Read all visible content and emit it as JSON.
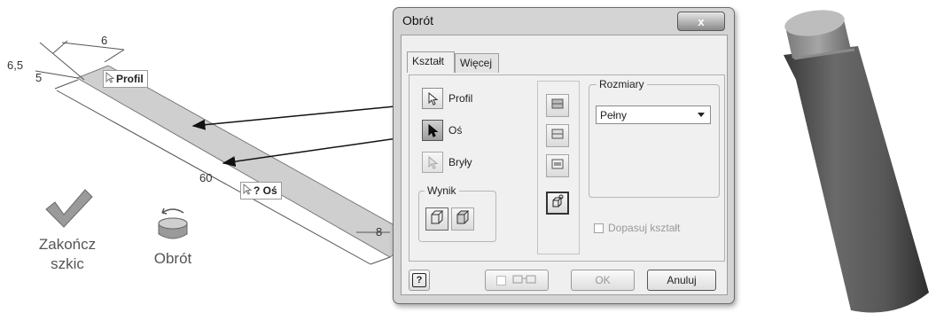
{
  "sketch": {
    "dimensions": {
      "d1": "6,5",
      "d2": "5",
      "d3": "6",
      "d4": "60",
      "d5": "8"
    },
    "profile_tag": "Profil",
    "axis_tag": "? Oś"
  },
  "ribbon": {
    "finish_label_line1": "Zakończ",
    "finish_label_line2": "szkic",
    "revolve_label": "Obrót"
  },
  "dialog": {
    "title": "Obrót",
    "close_symbol": "x",
    "tabs": [
      {
        "label": "Kształt",
        "active": true
      },
      {
        "label": "Więcej",
        "active": false
      }
    ],
    "selectors": [
      {
        "label": "Profil"
      },
      {
        "label": "Oś"
      },
      {
        "label": "Bryły"
      }
    ],
    "output_group": {
      "legend": "Wynik"
    },
    "extents": {
      "legend": "Rozmiary",
      "value": "Pełny"
    },
    "match_shape": {
      "label": "Dopasuj kształt",
      "checked": false
    },
    "footer": {
      "ok_label": "OK",
      "cancel_label": "Anuluj",
      "help_symbol": "?"
    }
  },
  "colors": {
    "face": "#c9c9c9",
    "dialog_bg": "#efefef",
    "accent": "#2d2d2d"
  }
}
